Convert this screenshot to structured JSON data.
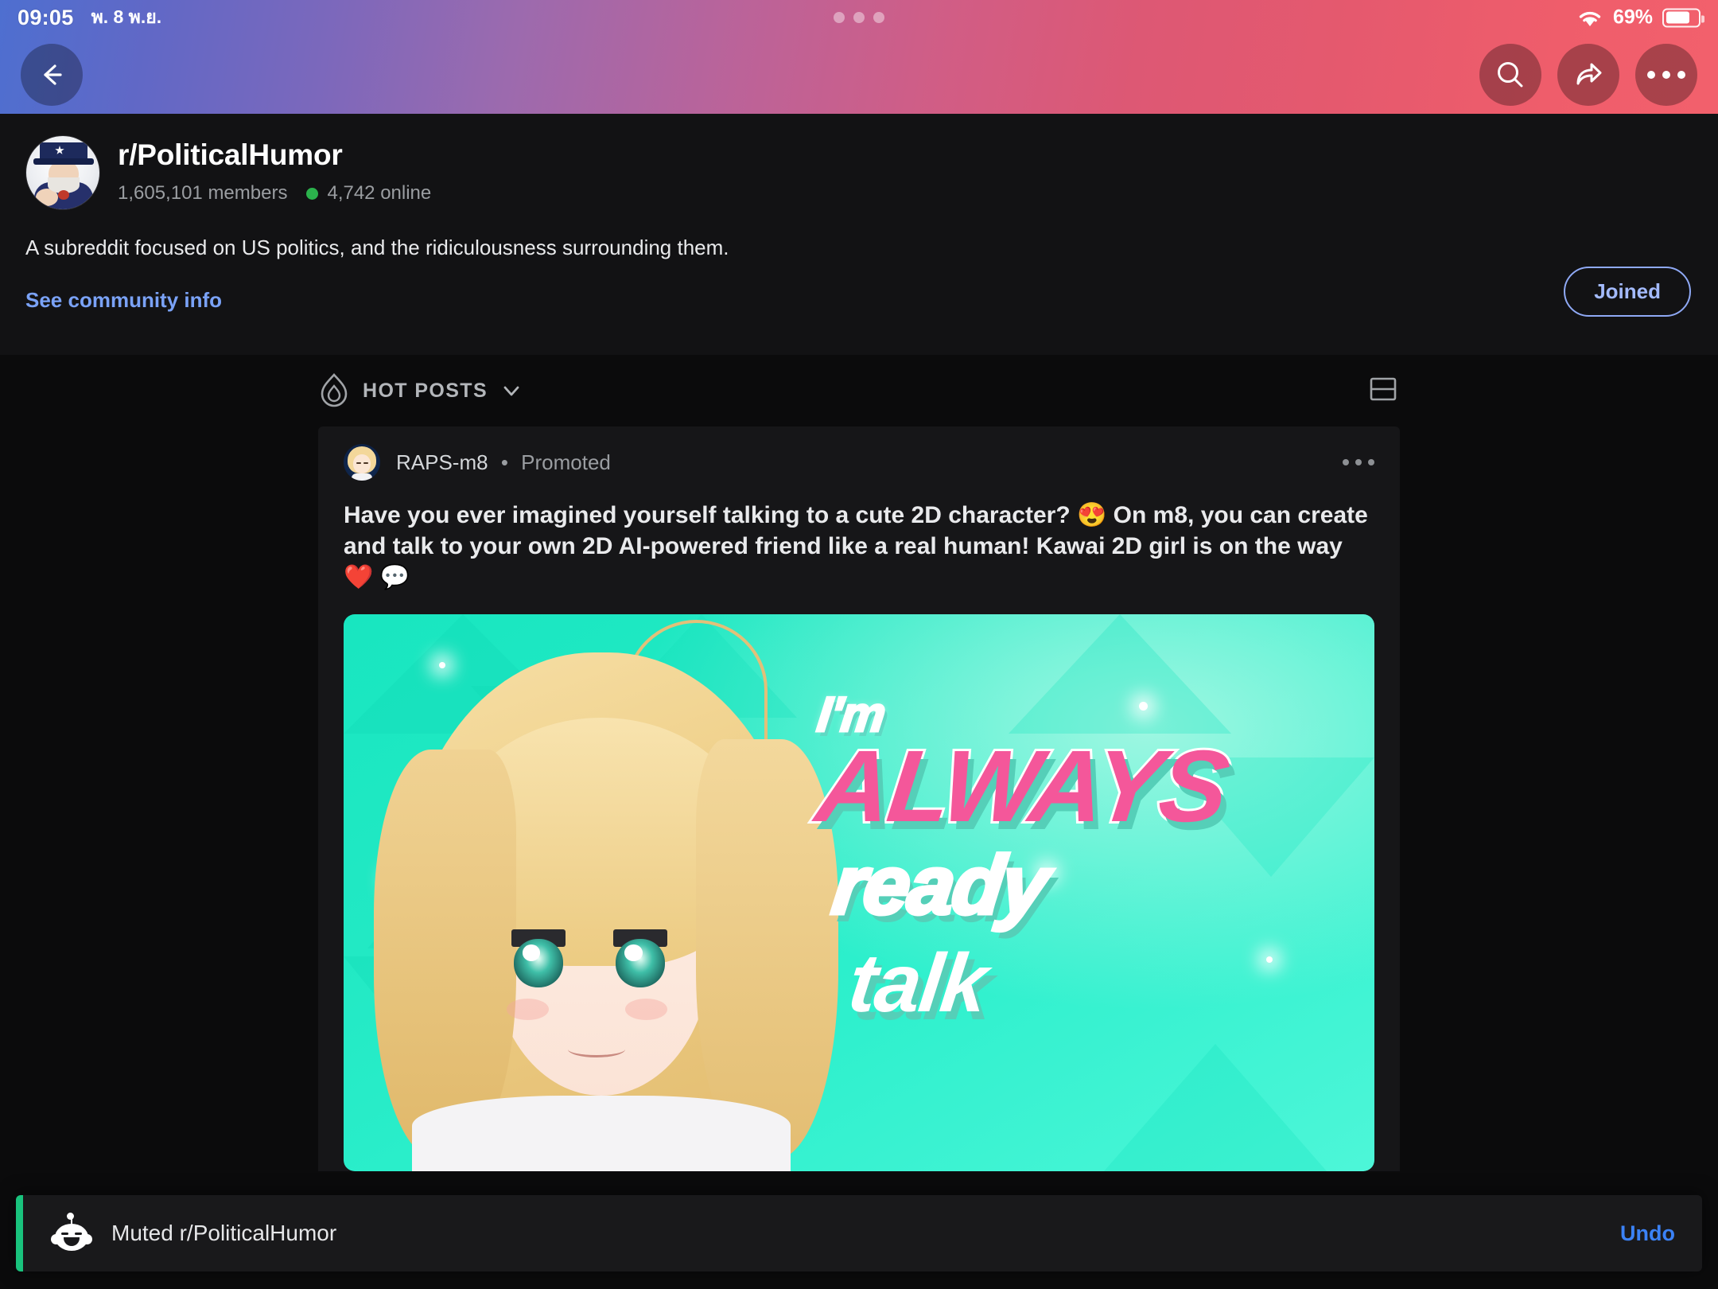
{
  "status_bar": {
    "time": "09:05",
    "date": "พ. 8 พ.ย.",
    "battery_percent": "69%",
    "wifi_icon": "wifi-icon",
    "battery_icon": "battery-icon",
    "center_dots_icon": "recording-dots-icon"
  },
  "nav": {
    "back_icon": "back-arrow-icon",
    "search_icon": "search-icon",
    "share_icon": "share-icon",
    "overflow_icon": "more-horizontal-icon"
  },
  "community": {
    "name": "r/PoliticalHumor",
    "members": "1,605,101 members",
    "online": "4,742 online",
    "online_dot_color": "#2bb24c",
    "description": "A subreddit focused on US politics, and the ridiculousness surrounding them.",
    "info_link": "See community info",
    "join_button": "Joined",
    "join_button_color": "#a3bafc",
    "avatar_icon": "uncle-sam-avatar"
  },
  "feed": {
    "sort": {
      "label": "HOT POSTS",
      "flame_icon": "flame-icon",
      "chevron_icon": "chevron-down-icon"
    },
    "layout_toggle_icon": "card-layout-icon"
  },
  "post": {
    "author": "RAPS-m8",
    "separator": "•",
    "promoted_label": "Promoted",
    "overflow_icon": "more-horizontal-icon",
    "avatar_icon": "anime-girl-avatar",
    "title": "Have you ever imagined yourself talking to a cute 2D character? 😍 On m8, you can create and talk to your own 2D AI-powered friend like a real human! Kawai 2D girl is on the way ❤️ 💬",
    "media": {
      "line1": "I'm",
      "line2": "ALWAYS",
      "line3": "ready",
      "line4": "talk",
      "background_color": "#22e9c4",
      "accent_color": "#f4579a"
    }
  },
  "snackbar": {
    "message": "Muted r/PoliticalHumor",
    "action": "Undo",
    "action_color": "#3b82f6",
    "accent_color": "#19c37d",
    "icon": "reddit-snoo-icon"
  }
}
